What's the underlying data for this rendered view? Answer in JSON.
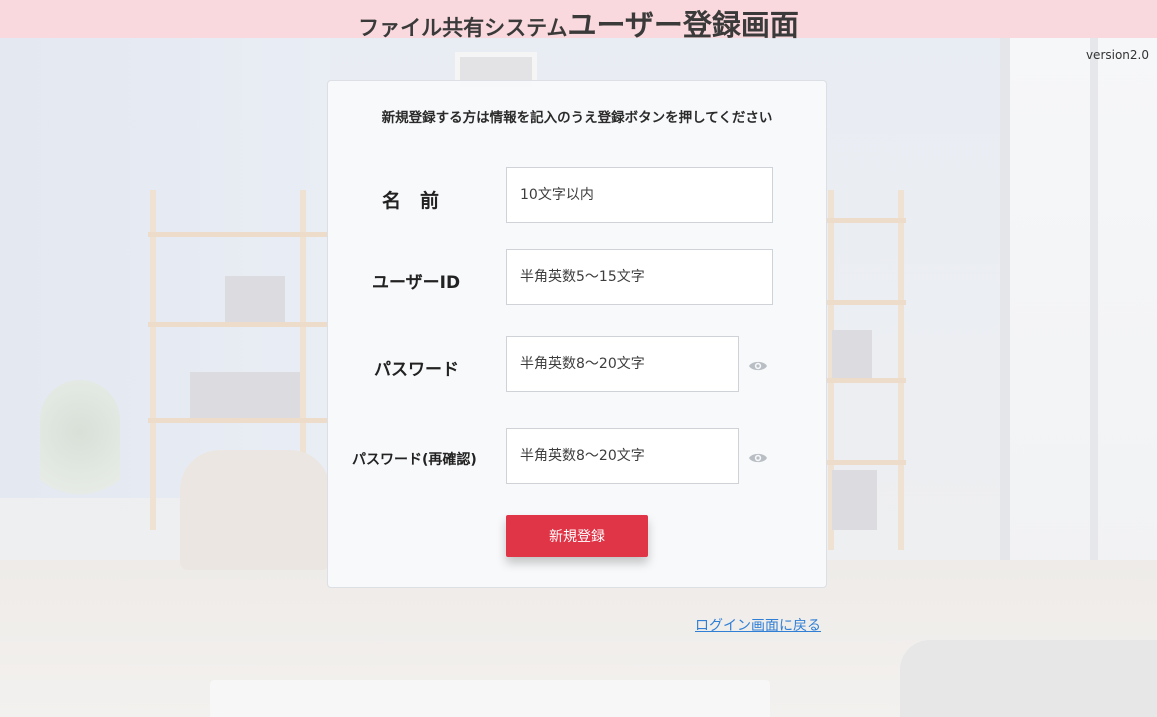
{
  "header": {
    "title_small": "ファイル共有システム",
    "title_big": "ユーザー登録画面"
  },
  "version": "version2.0",
  "form": {
    "instruction": "新規登録する方は情報を記入のうえ登録ボタンを押してください",
    "fields": [
      {
        "label": "名　前",
        "placeholder": "10文字以内",
        "type": "text"
      },
      {
        "label": "ユーザーID",
        "placeholder": "半角英数5～15文字",
        "type": "text"
      },
      {
        "label": "パスワード",
        "placeholder": "半角英数8～20文字",
        "type": "password",
        "icon": "eye-icon"
      },
      {
        "label": "パスワード(再確認)",
        "placeholder": "半角英数8～20文字",
        "type": "password",
        "icon": "eye-icon"
      }
    ],
    "submit_label": "新規登録"
  },
  "back_link": "ログイン画面に戻る",
  "colors": {
    "header_bg": "#f9d9dd",
    "submit_bg": "#e03447",
    "link": "#2f7fd6"
  }
}
